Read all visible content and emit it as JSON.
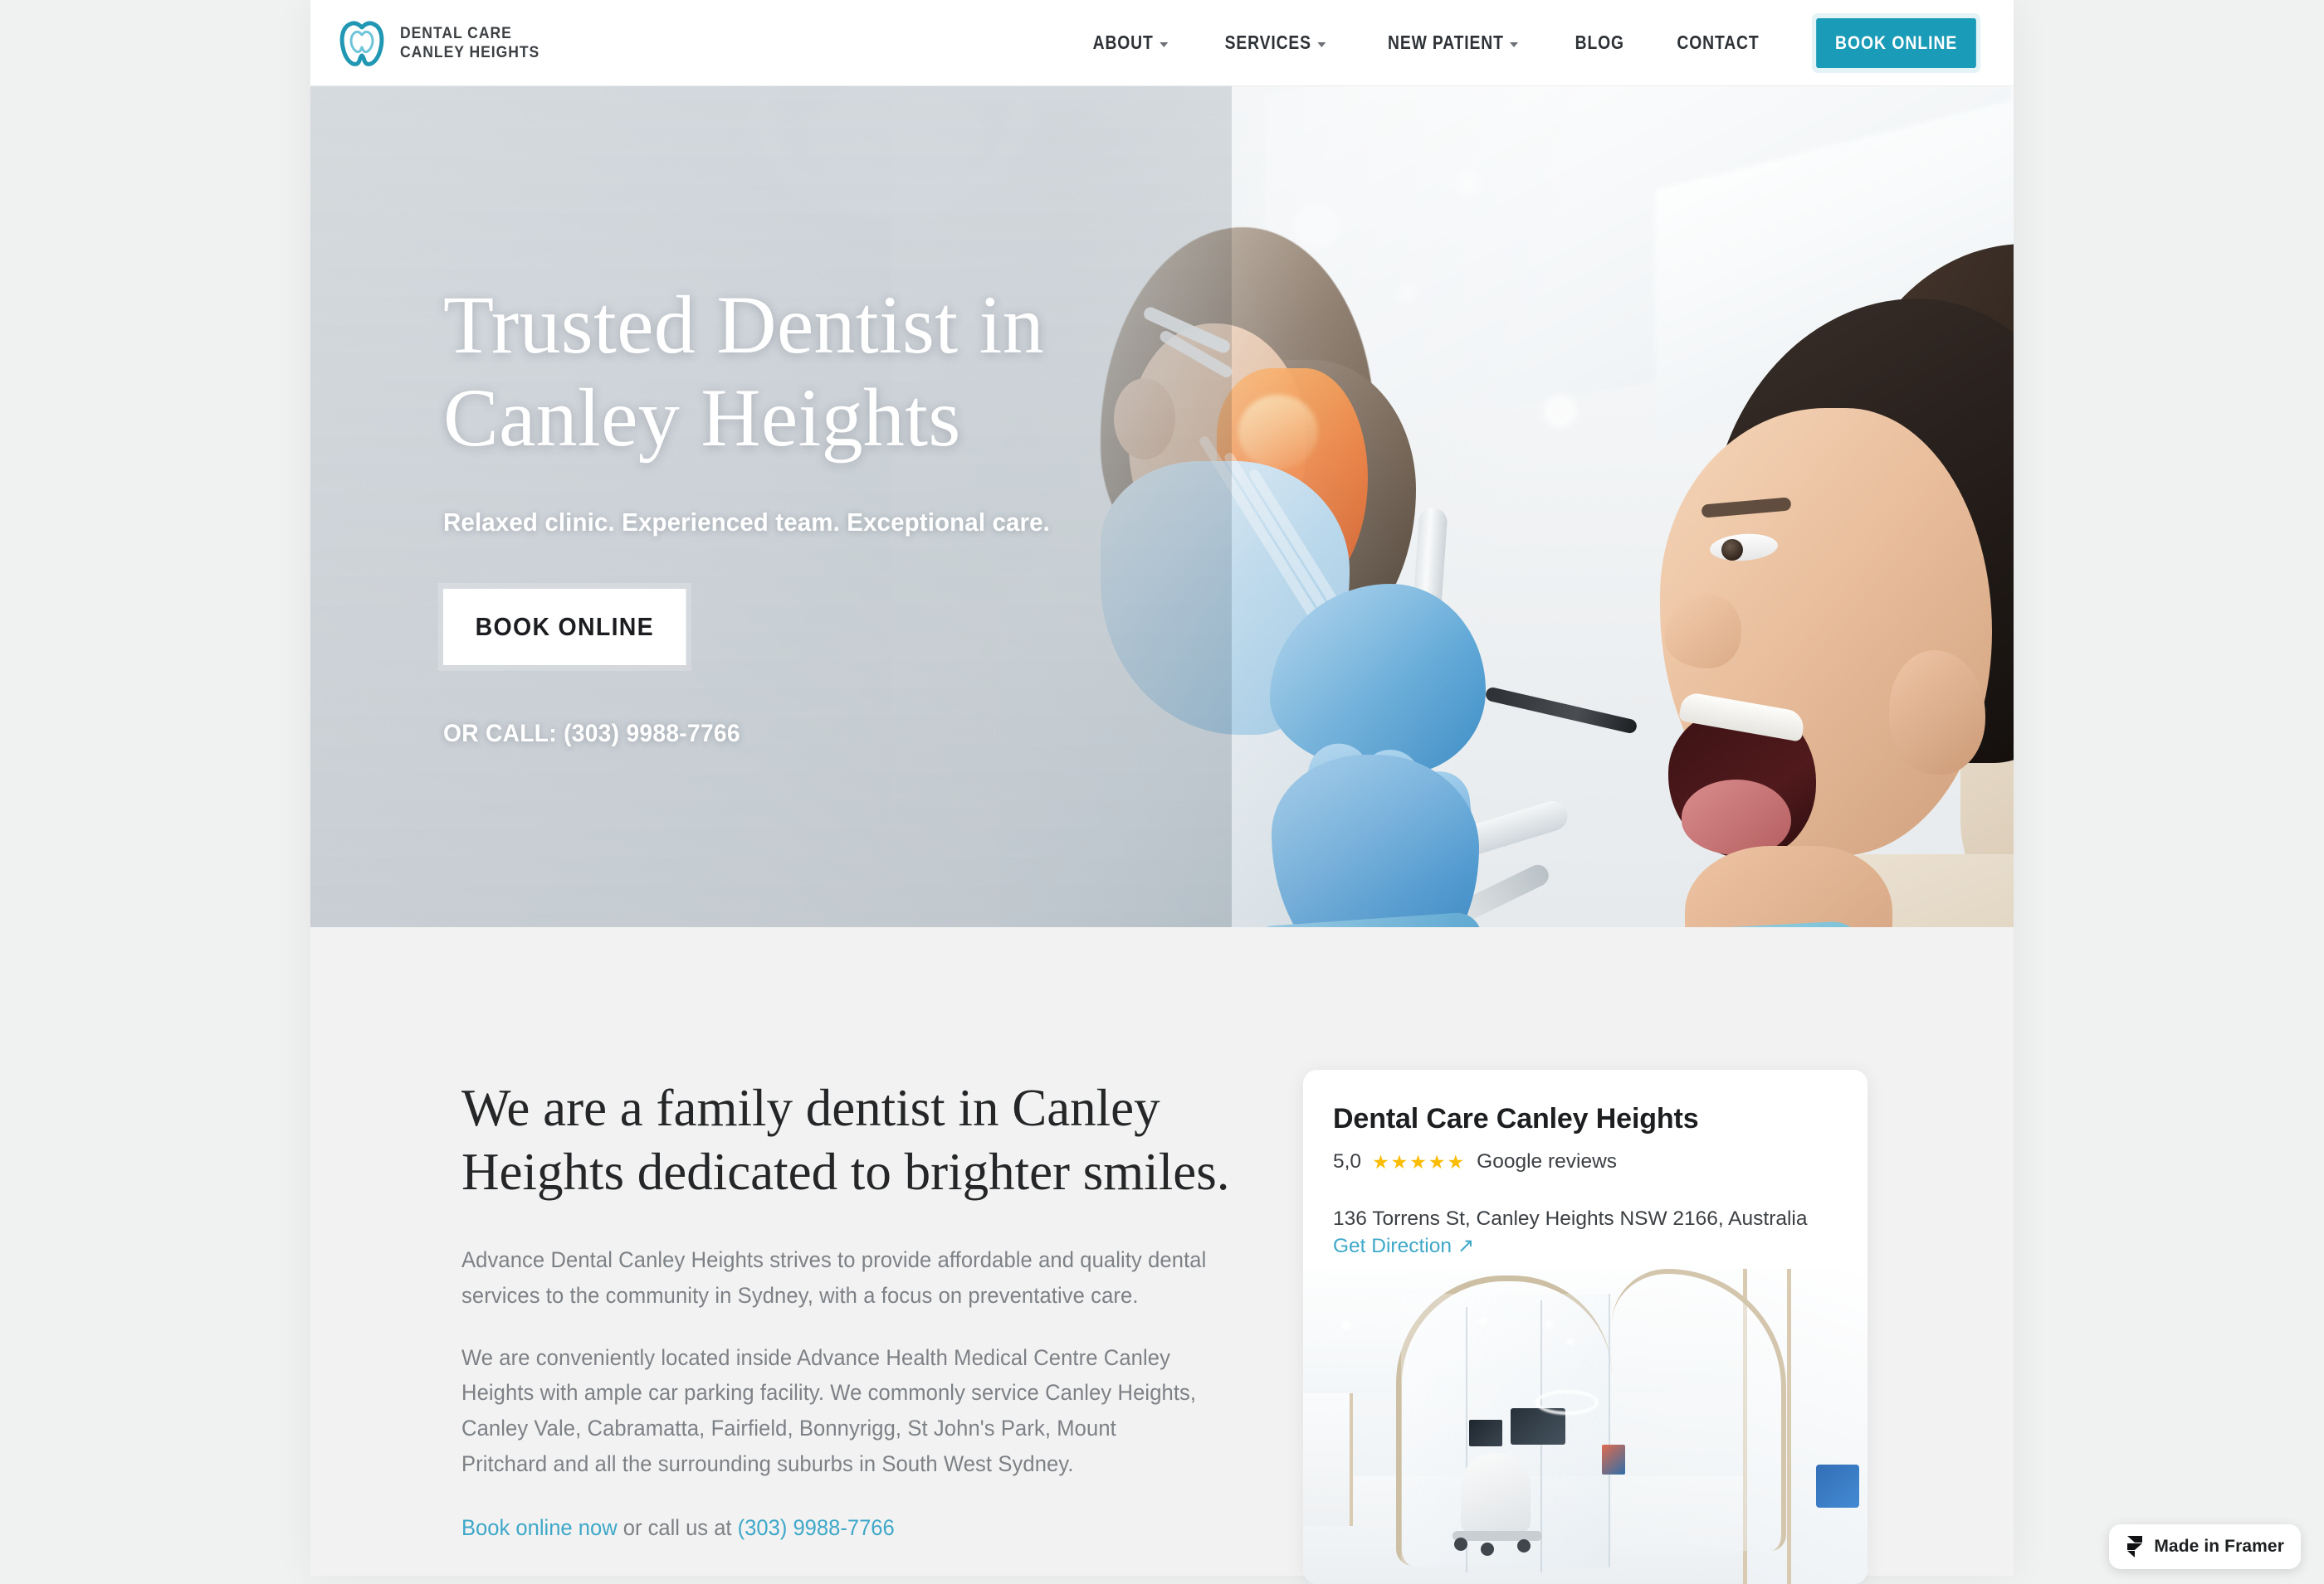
{
  "header": {
    "logo": {
      "line1": "DENTAL CARE",
      "line2": "CANLEY HEIGHTS",
      "icon": "tooth-heart-logo"
    },
    "nav": [
      {
        "label": "ABOUT",
        "has_dropdown": true
      },
      {
        "label": "SERVICES",
        "has_dropdown": true
      },
      {
        "label": "NEW PATIENT",
        "has_dropdown": true
      },
      {
        "label": "BLOG",
        "has_dropdown": false
      },
      {
        "label": "CONTACT",
        "has_dropdown": false
      }
    ],
    "cta_label": "BOOK ONLINE"
  },
  "hero": {
    "heading_line1": "Trusted Dentist in",
    "heading_line2": "Canley Heights",
    "subheading": "Relaxed clinic. Experienced team. Exceptional care.",
    "button_label": "BOOK ONLINE",
    "call_text": "OR CALL: (303) 9988-7766"
  },
  "about": {
    "heading": "We are a family dentist in Canley Heights dedicated to brighter smiles.",
    "paragraph1": "Advance Dental Canley Heights strives to provide affordable and quality dental services to the community in Sydney, with a focus on preventative care.",
    "paragraph2": "We are conveniently located inside Advance Health Medical Centre Canley Heights with ample car parking facility. We commonly service Canley Heights, Canley Vale, Cabramatta, Fairfield, Bonnyrigg, St John's Park, Mount Pritchard and all the surrounding suburbs in South West Sydney.",
    "link_book": "Book online now",
    "link_middle": " or call us at ",
    "link_phone": "(303) 9988-7766"
  },
  "review_card": {
    "title": "Dental Care Canley Heights",
    "rating": "5,0",
    "stars": "★★★★★",
    "reviews_label": "Google reviews",
    "address": "136 Torrens St, Canley Heights NSW 2166, Australia",
    "direction_label": "Get Direction ↗",
    "photo_alt": "dental-clinic-interior"
  },
  "framer_badge": {
    "label": "Made in Framer"
  },
  "colors": {
    "accent_teal": "#1a9bb7",
    "link_blue": "#3fa8c9",
    "star_yellow": "#fbbc04",
    "page_bg": "#f0f1f1",
    "section_bg": "#f2f2f2",
    "heading_dark": "#242628",
    "body_gray": "#7d8186"
  }
}
